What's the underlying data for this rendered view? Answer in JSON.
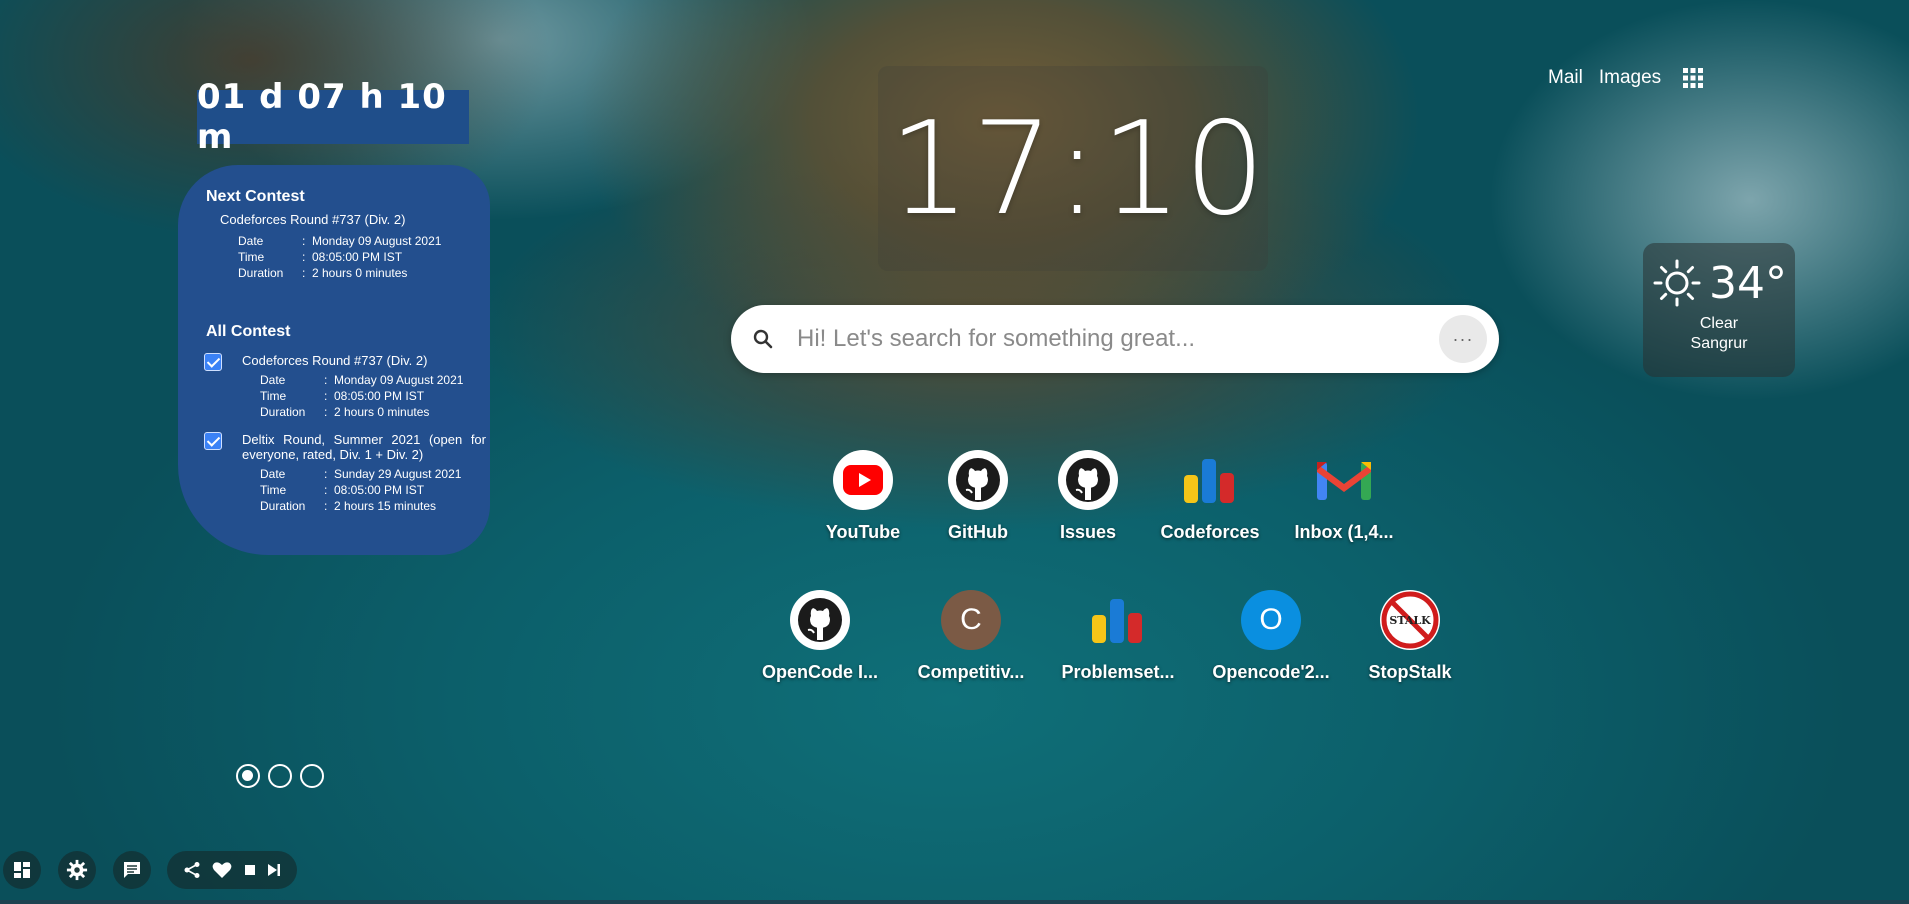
{
  "countdown": {
    "text": "01 d  07 h  10 m"
  },
  "next_contest": {
    "heading": "Next Contest",
    "name": "Codeforces Round #737 (Div. 2)",
    "details": [
      {
        "key": "Date",
        "value": "Monday 09 August 2021"
      },
      {
        "key": "Time",
        "value": "08:05:00 PM IST"
      },
      {
        "key": "Duration",
        "value": "2 hours 0 minutes"
      }
    ]
  },
  "all_contest": {
    "heading": "All Contest",
    "items": [
      {
        "name": "Codeforces Round #737 (Div. 2)",
        "checked": true,
        "details": [
          {
            "key": "Date",
            "value": "Monday 09 August 2021"
          },
          {
            "key": "Time",
            "value": "08:05:00 PM IST"
          },
          {
            "key": "Duration",
            "value": "2 hours 0 minutes"
          }
        ]
      },
      {
        "name": "Deltix Round, Summer 2021 (open for everyone, rated, Div. 1 + Div. 2)",
        "checked": true,
        "details": [
          {
            "key": "Date",
            "value": "Sunday 29 August 2021"
          },
          {
            "key": "Time",
            "value": "08:05:00 PM IST"
          },
          {
            "key": "Duration",
            "value": "2 hours 15 minutes"
          }
        ]
      }
    ]
  },
  "detail_separator": ":",
  "clock": {
    "time": "17:10"
  },
  "search": {
    "placeholder": "Hi! Let's search for something great...",
    "more_label": "···"
  },
  "top_links": {
    "mail": "Mail",
    "images": "Images"
  },
  "weather": {
    "temp": "34°",
    "condition": "Clear",
    "location": "Sangrur"
  },
  "shortcuts_row1": [
    {
      "label": "YouTube",
      "icon": "youtube-icon",
      "bg": "#ffffff"
    },
    {
      "label": "GitHub",
      "icon": "github-icon",
      "bg": "#ffffff"
    },
    {
      "label": "Issues",
      "icon": "github-icon",
      "bg": "#ffffff"
    },
    {
      "label": "Codeforces",
      "icon": "codeforces-icon",
      "bg": "transparent"
    },
    {
      "label": "Inbox (1,4...",
      "icon": "gmail-icon",
      "bg": "transparent"
    }
  ],
  "shortcuts_row2": [
    {
      "label": "OpenCode I...",
      "icon": "github-icon",
      "bg": "#ffffff"
    },
    {
      "label": "Competitiv...",
      "icon": "letter-c-icon",
      "letter": "C",
      "bg": "#7b5a45"
    },
    {
      "label": "Problemset...",
      "icon": "codeforces-icon",
      "bg": "transparent"
    },
    {
      "label": "Opencode'2...",
      "icon": "letter-o-icon",
      "letter": "O",
      "bg": "#0a8fe0"
    },
    {
      "label": "StopStalk",
      "icon": "stopstalk-icon",
      "bg": "#ffffff"
    }
  ],
  "colors": {
    "panel": "#234f8e",
    "countdown": "#1f4e8a",
    "youtube": "#ff0000",
    "checkbox": "#3b82f6"
  }
}
